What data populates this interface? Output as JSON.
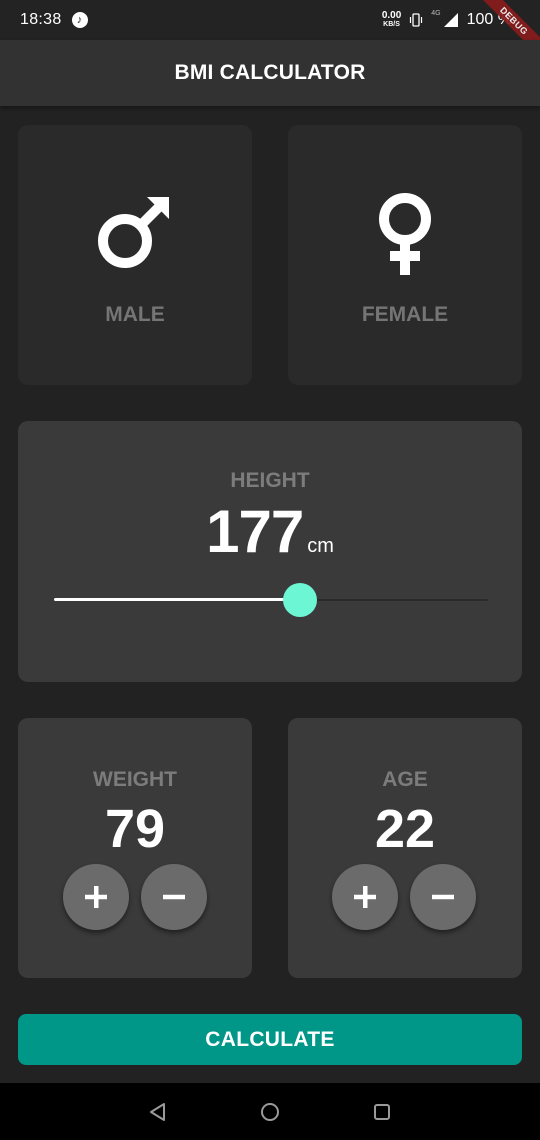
{
  "status_bar": {
    "time": "18:38",
    "net_speed_value": "0.00",
    "net_speed_unit": "KB/S",
    "network_type": "4G",
    "battery": "100 %",
    "debug_banner": "DEBUG"
  },
  "app_bar": {
    "title": "BMI CALCULATOR"
  },
  "gender": {
    "male_label": "MALE",
    "female_label": "FEMALE"
  },
  "height": {
    "label": "HEIGHT",
    "value": "177",
    "unit": "cm",
    "slider_fraction": 0.567
  },
  "weight": {
    "label": "WEIGHT",
    "value": "79"
  },
  "age": {
    "label": "AGE",
    "value": "22"
  },
  "calculate_button": {
    "label": "CALCULATE"
  },
  "icons": {
    "music": "music-note-icon",
    "plus": "plus-icon",
    "minus": "minus-icon",
    "male": "male-symbol-icon",
    "female": "female-symbol-icon"
  },
  "colors": {
    "accent": "#6cf6d4",
    "button": "#009688",
    "card": "#3a3a3a",
    "card_inactive": "#2a2a2a",
    "background": "#222222"
  }
}
